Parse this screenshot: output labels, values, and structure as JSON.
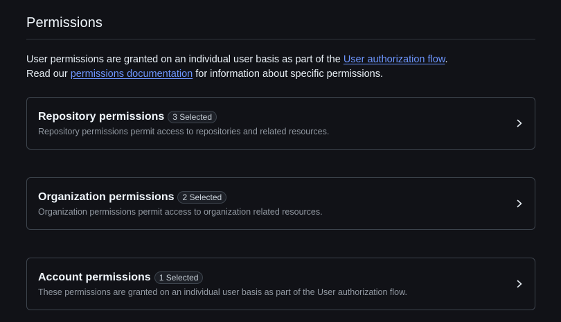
{
  "section": {
    "title": "Permissions",
    "intro_line1_prefix": "User permissions are granted on an individual user basis as part of the ",
    "intro_line1_link": "User authorization flow",
    "intro_line1_suffix": ".",
    "intro_line2_prefix": "Read our ",
    "intro_line2_link": "permissions documentation",
    "intro_line2_suffix": " for information about specific permissions."
  },
  "cards": [
    {
      "title": "Repository permissions",
      "badge": "3 Selected",
      "description": "Repository permissions permit access to repositories and related resources."
    },
    {
      "title": "Organization permissions",
      "badge": "2 Selected",
      "description": "Organization permissions permit access to organization related resources."
    },
    {
      "title": "Account permissions",
      "badge": "1 Selected",
      "description": "These permissions are granted on an individual user basis as part of the User authorization flow."
    }
  ],
  "icons": {
    "card_arrow": "chevron-right-icon"
  },
  "colors": {
    "background": "#111217",
    "link": "#6d96ff",
    "border": "#3d444d",
    "muted_text": "#9198a1"
  }
}
